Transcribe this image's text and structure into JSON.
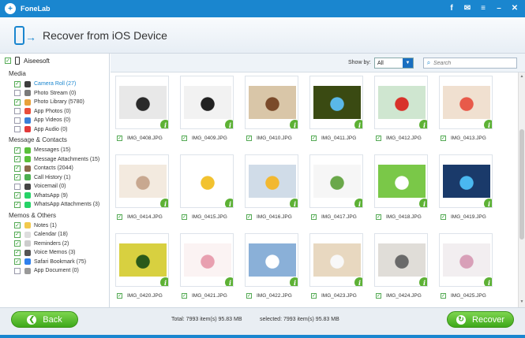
{
  "app": {
    "title": "FoneLab"
  },
  "window_controls": {
    "facebook": "f",
    "chat": "✉",
    "menu": "≡",
    "minimize": "–",
    "close": "✕"
  },
  "header": {
    "title": "Recover from iOS Device"
  },
  "sidebar": {
    "device": "Aiseesoft",
    "groups": [
      {
        "title": "Media",
        "items": [
          {
            "label": "Camera Roll (27)",
            "checked": true,
            "active": true,
            "color": "#3d3d3d"
          },
          {
            "label": "Photo Stream (0)",
            "checked": false,
            "active": false,
            "color": "#7a7a7a"
          },
          {
            "label": "Photo Library (5780)",
            "checked": true,
            "active": false,
            "color": "#e8a13a"
          },
          {
            "label": "App Photos (0)",
            "checked": false,
            "active": false,
            "color": "#e94e3c"
          },
          {
            "label": "App Videos (0)",
            "checked": false,
            "active": false,
            "color": "#3a7fd8"
          },
          {
            "label": "App Audio (0)",
            "checked": false,
            "active": false,
            "color": "#e23a3a"
          }
        ]
      },
      {
        "title": "Message & Contacts",
        "items": [
          {
            "label": "Messages (15)",
            "checked": true,
            "active": false,
            "color": "#5ac03a"
          },
          {
            "label": "Message Attachments (15)",
            "checked": true,
            "active": false,
            "color": "#5ac03a"
          },
          {
            "label": "Contacts (2044)",
            "checked": true,
            "active": false,
            "color": "#8a6a4a"
          },
          {
            "label": "Call History (1)",
            "checked": true,
            "active": false,
            "color": "#4caf50"
          },
          {
            "label": "Voicemail (0)",
            "checked": false,
            "active": false,
            "color": "#444444"
          },
          {
            "label": "WhatsApp (9)",
            "checked": true,
            "active": false,
            "color": "#25d366"
          },
          {
            "label": "WhatsApp Attachments (3)",
            "checked": true,
            "active": false,
            "color": "#25d366"
          }
        ]
      },
      {
        "title": "Memos & Others",
        "items": [
          {
            "label": "Notes (1)",
            "checked": true,
            "active": false,
            "color": "#f2c94c"
          },
          {
            "label": "Calendar (18)",
            "checked": true,
            "active": false,
            "color": "#dddddd"
          },
          {
            "label": "Reminders (2)",
            "checked": true,
            "active": false,
            "color": "#cccccc"
          },
          {
            "label": "Voice Memos (3)",
            "checked": true,
            "active": false,
            "color": "#555555"
          },
          {
            "label": "Safari Bookmark (75)",
            "checked": true,
            "active": false,
            "color": "#2f80ed"
          },
          {
            "label": "App Document (0)",
            "checked": false,
            "active": false,
            "color": "#999999"
          }
        ]
      }
    ]
  },
  "toolbar": {
    "show_by_label": "Show by:",
    "show_by_value": "All",
    "search_placeholder": "Search"
  },
  "photos": [
    {
      "name": "IMG_0408.JPG",
      "colors": [
        "#e8e8e8",
        "#2a2a2a"
      ]
    },
    {
      "name": "IMG_0409.JPG",
      "colors": [
        "#f2f2f2",
        "#222222"
      ]
    },
    {
      "name": "IMG_0410.JPG",
      "colors": [
        "#d9c6a8",
        "#7a4a2a"
      ]
    },
    {
      "name": "IMG_0411.JPG",
      "colors": [
        "#3a4a12",
        "#5ab8e8"
      ]
    },
    {
      "name": "IMG_0412.JPG",
      "colors": [
        "#cfe6d0",
        "#d8322a"
      ]
    },
    {
      "name": "IMG_0413.JPG",
      "colors": [
        "#f0e0d0",
        "#e85a4a"
      ]
    },
    {
      "name": "IMG_0414.JPG",
      "colors": [
        "#f3eadf",
        "#c8a890"
      ]
    },
    {
      "name": "IMG_0415.JPG",
      "colors": [
        "#ffffff",
        "#f2c230"
      ]
    },
    {
      "name": "IMG_0416.JPG",
      "colors": [
        "#d0dce8",
        "#f2b830"
      ]
    },
    {
      "name": "IMG_0417.JPG",
      "colors": [
        "#f6f6f6",
        "#6aa84a"
      ]
    },
    {
      "name": "IMG_0418.JPG",
      "colors": [
        "#7ac848",
        "#ffffff"
      ]
    },
    {
      "name": "IMG_0419.JPG",
      "colors": [
        "#1a3a6a",
        "#4ab8f0"
      ]
    },
    {
      "name": "IMG_0420.JPG",
      "colors": [
        "#d8d040",
        "#2a5a1a"
      ]
    },
    {
      "name": "IMG_0421.JPG",
      "colors": [
        "#fbf3f3",
        "#e8a0b0"
      ]
    },
    {
      "name": "IMG_0422.JPG",
      "colors": [
        "#8ab0d8",
        "#ffffff"
      ]
    },
    {
      "name": "IMG_0423.JPG",
      "colors": [
        "#e8d8c0",
        "#f8f8f8"
      ]
    },
    {
      "name": "IMG_0424.JPG",
      "colors": [
        "#e0ddd8",
        "#6a6a6a"
      ]
    },
    {
      "name": "IMG_0425.JPG",
      "colors": [
        "#f2eef0",
        "#d8a0b8"
      ]
    }
  ],
  "footer": {
    "back_label": "Back",
    "recover_label": "Recover",
    "total_text": "Total: 7993 item(s) 95.83 MB",
    "selected_text": "selected: 7993 item(s) 95.83 MB"
  },
  "accent_color": "#1a86cf",
  "button_color": "#4cb52a"
}
